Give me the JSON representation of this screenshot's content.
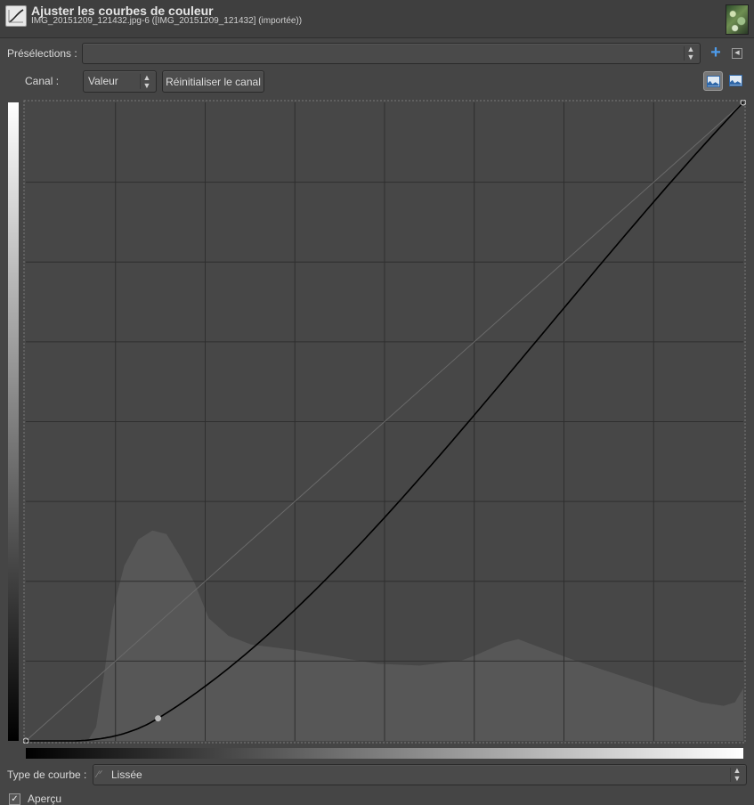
{
  "header": {
    "title": "Ajuster les courbes de couleur",
    "subtitle": "IMG_20151209_121432.jpg-6 ([IMG_20151209_121432] (importée))"
  },
  "presets": {
    "label": "Présélections :",
    "value": "",
    "add_icon": "plus-icon",
    "toggle_icon": "collapse-panel-icon"
  },
  "channel": {
    "label": "Canal :",
    "value": "Valeur",
    "reset_label": "Réinitialiser le canal",
    "linear_hist_icon": "linear-histogram-icon",
    "log_hist_icon": "logarithmic-histogram-icon"
  },
  "curve_type": {
    "label": "Type de courbe :",
    "value": "Lissée",
    "icon": "smooth-curve-icon"
  },
  "preview": {
    "label": "Aperçu",
    "checked": true
  },
  "curve": {
    "channel": "Valeur",
    "control_points": [
      [
        0,
        0
      ],
      [
        47,
        9
      ],
      [
        255,
        255
      ]
    ]
  },
  "colors": {
    "background": "#454545",
    "grid": "#2f2f2f",
    "histogram": "#575757",
    "curve": "#000000",
    "accent": "#4d9bea"
  }
}
